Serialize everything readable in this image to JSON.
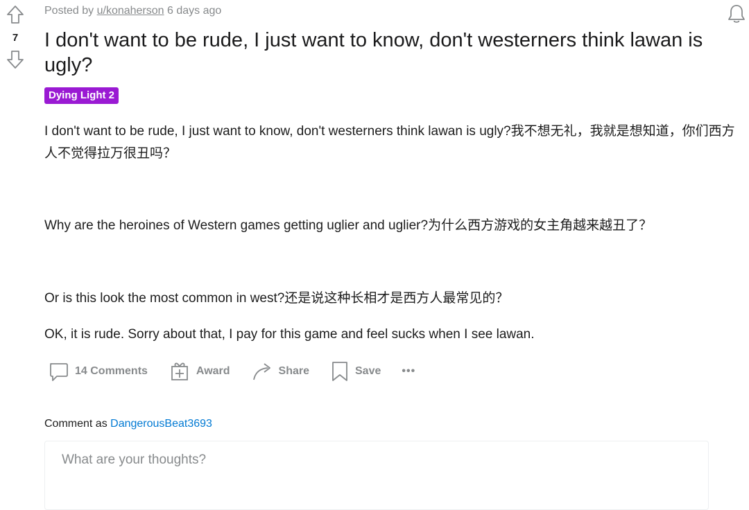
{
  "post": {
    "votes": "7",
    "meta_prefix": "Posted by",
    "author": "u/konaherson",
    "time": "6 days ago",
    "title": "I don't want to be rude, I just want to know, don't westerners think lawan is ugly?",
    "flair": "Dying Light 2",
    "flair_color": "#9a1ad3",
    "paragraphs": [
      "I don't want to be rude, I just want to know, don't westerners think lawan is ugly?我不想无礼，我就是想知道，你们西方人不觉得拉万很丑吗？",
      "Why are the heroines of Western games getting uglier and uglier?为什么西方游戏的女主角越来越丑了？",
      "Or is this look the most common in west?还是说这种长相才是西方人最常见的？",
      "OK, it is rude. Sorry about that, I pay for this game and feel sucks when I see lawan."
    ]
  },
  "actions": {
    "comments": "14 Comments",
    "award": "Award",
    "share": "Share",
    "save": "Save",
    "more": "•••"
  },
  "comment": {
    "label": "Comment as",
    "user": "DangerousBeat3693",
    "placeholder": "What are your thoughts?"
  },
  "icons": {
    "upvote": "arrow-up-icon",
    "downvote": "arrow-down-icon",
    "bell": "bell-icon",
    "comment": "comment-bubble-icon",
    "award": "gift-icon",
    "share": "share-arrow-icon",
    "save": "bookmark-icon",
    "more": "more-dots-icon"
  },
  "colors": {
    "muted": "#878a8c",
    "link": "#0079d3",
    "text": "#1c1c1c"
  }
}
